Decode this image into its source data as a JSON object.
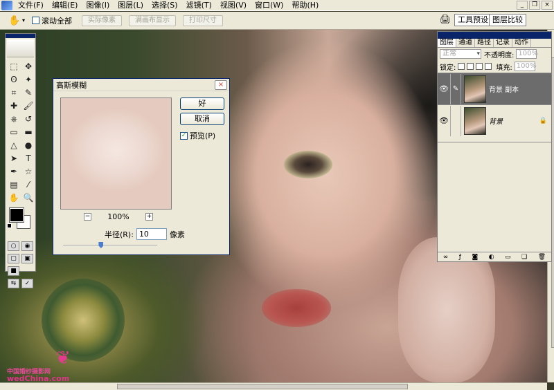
{
  "menubar": {
    "items": [
      "文件(F)",
      "编辑(E)",
      "图像(I)",
      "图层(L)",
      "选择(S)",
      "滤镜(T)",
      "视图(V)",
      "窗口(W)",
      "帮助(H)"
    ],
    "window_buttons": [
      "_",
      "❐",
      "×"
    ]
  },
  "options": {
    "tool_icon": "hand-icon",
    "scroll_all_label": "滚动全部",
    "scroll_all_checked": false,
    "actual_pixels": "实际像素",
    "fit_screen": "满画布显示",
    "print_size": "打印尺寸",
    "tool_presets": "工具预设",
    "layer_comps": "图层比较"
  },
  "dialog": {
    "title": "高斯模糊",
    "ok": "好",
    "cancel": "取消",
    "preview_label": "预览(P)",
    "preview_checked": true,
    "zoom": "100%",
    "zoom_out": "−",
    "zoom_in": "+",
    "radius_label": "半径(R):",
    "radius_value": "10",
    "radius_unit": "像素",
    "slider_fraction": 0.4,
    "close": "×"
  },
  "layers_panel": {
    "tabs": [
      "图层",
      "通道",
      "路径",
      "记录",
      "动作"
    ],
    "blend_mode": "正常",
    "opacity_label": "不透明度:",
    "opacity_value": "100%",
    "lock_label": "锁定:",
    "fill_label": "填充:",
    "fill_value": "100%",
    "layers": [
      {
        "name": "背景 副本",
        "selected": true,
        "visible": true
      },
      {
        "name": "背景",
        "selected": false,
        "visible": true,
        "locked": true
      }
    ],
    "footer_icons": [
      "link-icon",
      "fx-icon",
      "mask-icon",
      "adjustment-icon",
      "folder-icon",
      "new-layer-icon",
      "trash-icon"
    ]
  },
  "watermark": {
    "line1": "中国婚纱摄影网",
    "line2_a": "wed",
    "line2_b": "China",
    "line2_c": ".com"
  },
  "colors": {
    "foreground": "#000000",
    "background": "#ffffff",
    "title_blue": "#0a246a",
    "watermark_pink": "#e2358a"
  }
}
